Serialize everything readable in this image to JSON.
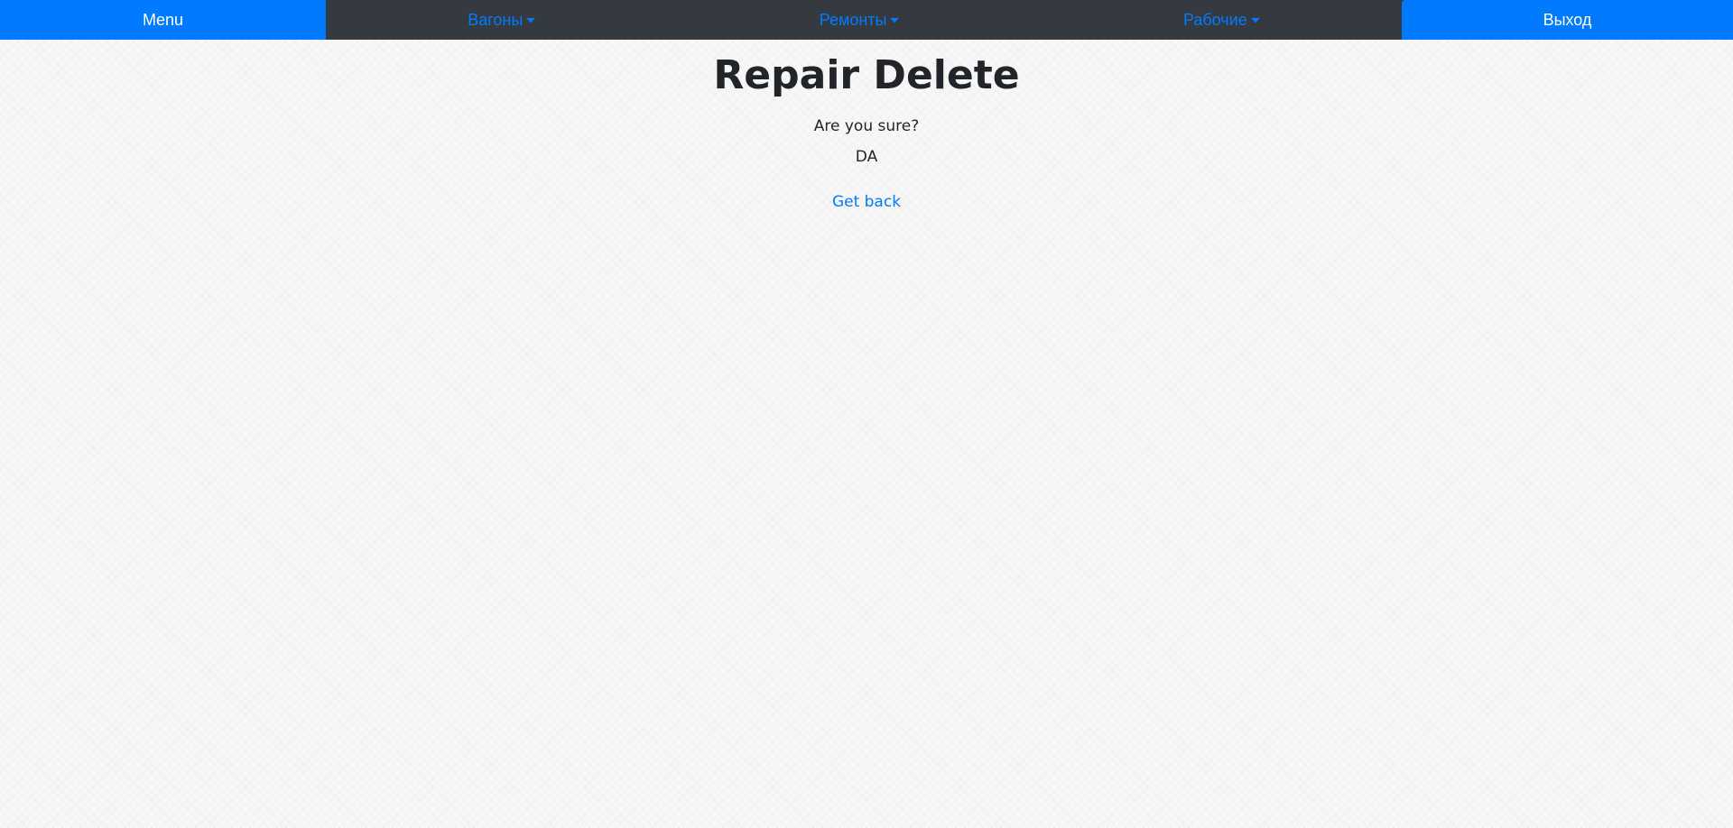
{
  "navbar": {
    "menu_label": "Menu",
    "dropdowns": [
      {
        "label": "Вагоны"
      },
      {
        "label": "Ремонты"
      },
      {
        "label": "Рабочие"
      }
    ],
    "logout_label": "Выход"
  },
  "main": {
    "title": "Repair Delete",
    "question": "Are you sure?",
    "answer": "DA",
    "back_link": "Get back"
  },
  "colors": {
    "primary": "#007bff",
    "navbar_bg": "#343a40",
    "text": "#212529"
  }
}
